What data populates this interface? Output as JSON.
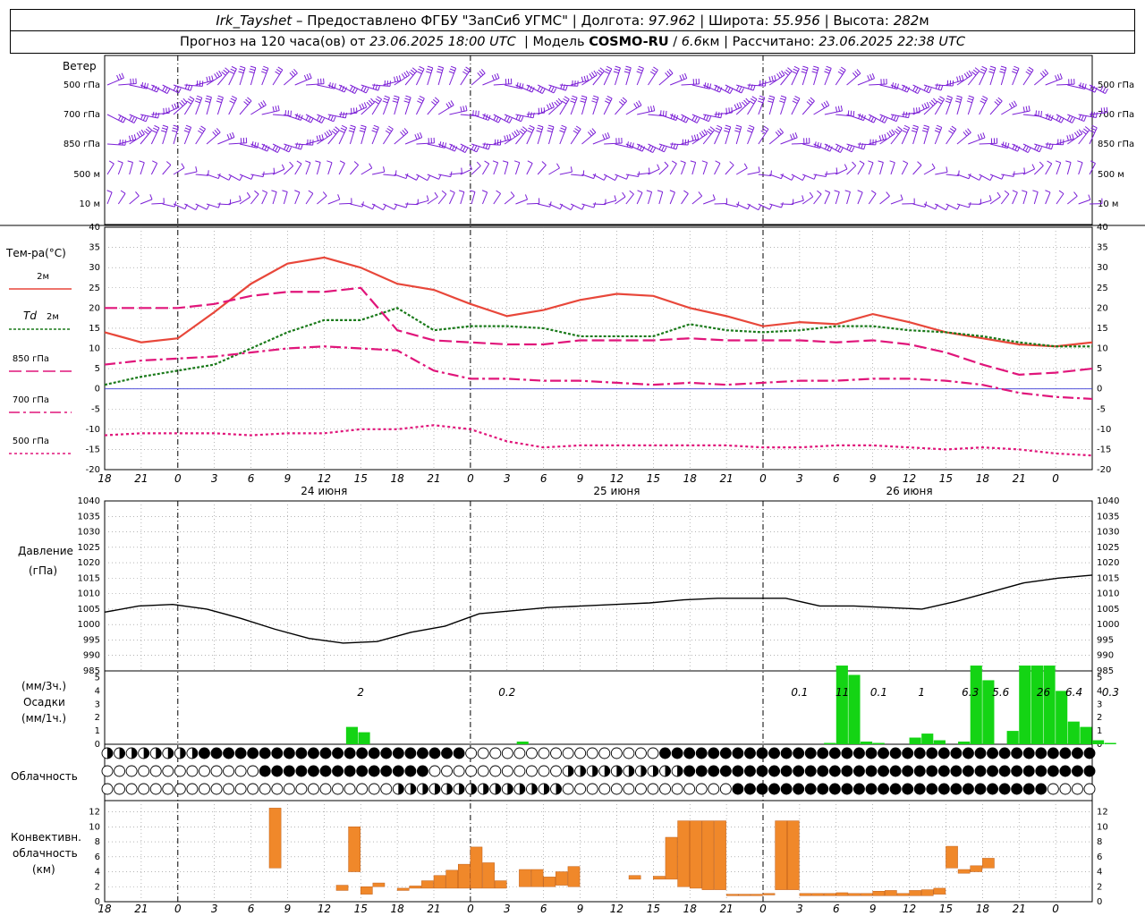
{
  "header": {
    "station": "Irk_Tayshet",
    "provider": "Предоставлено ФГБУ \"ЗапСиб УГМС\"",
    "lon_label": "Долгота:",
    "lon": "97.962",
    "lat_label": "Широта:",
    "lat": "55.956",
    "alt_label": "Высота:",
    "alt": "282",
    "alt_unit": "м",
    "forecast_prefix": "Прогноз на 120 часа(ов) от",
    "forecast_time": "23.06.2025 18:00 UTC",
    "model_label": "Модель",
    "model": "COSMO-RU",
    "model_res": "6.6",
    "model_res_unit": "км",
    "calc_label": "Рассчитано:",
    "calc_time": "23.06.2025 22:38 UTC"
  },
  "wind": {
    "title": "Ветер",
    "levels": [
      "500 гПа",
      "700 гПа",
      "850 гПа",
      "500 м",
      "10 м"
    ],
    "color": "#7b1fd6"
  },
  "temp": {
    "title": "Тем-ра(°C)",
    "legend": [
      {
        "label": "2м",
        "color": "#e8473a"
      },
      {
        "label": "Td",
        "label2": "2м",
        "color": "#1a7a1a"
      },
      {
        "label": "850 гПа",
        "color": "#e0157a"
      },
      {
        "label": "700 гПа",
        "color": "#e0157a"
      },
      {
        "label": "500 гПа",
        "color": "#e0157a"
      }
    ]
  },
  "pressure": {
    "title": "Давление",
    "unit": "(гПа)"
  },
  "precip": {
    "label1": "(мм/3ч.)",
    "label2": "Осадки",
    "label3": "(мм/1ч.)",
    "totals": [
      "2",
      "0.2",
      "0.1",
      "11",
      "0.1",
      "1",
      "6.3",
      "5.6",
      "26",
      "6.4",
      "0.3"
    ],
    "color": "#14d414"
  },
  "clouds": {
    "title": "Облачность"
  },
  "convective": {
    "label1": "Конвективн.",
    "label2": "облачность",
    "label3": "(км)",
    "color": "#f0882a"
  },
  "x_ticks": [
    "18",
    "21",
    "0",
    "3",
    "6",
    "9",
    "12",
    "15",
    "18",
    "21",
    "0",
    "3",
    "6",
    "9",
    "12",
    "15",
    "18",
    "21",
    "0",
    "3",
    "6",
    "9",
    "12",
    "15",
    "18",
    "21",
    "0"
  ],
  "days": [
    "24 июня",
    "25 июня",
    "26 июня"
  ],
  "chart_data": [
    {
      "type": "line",
      "title": "Тем-ра(°C)",
      "x_start": "23.06 18 UTC",
      "x_step_hours": 3,
      "ylim": [
        -20,
        40
      ],
      "yticks": [
        -20,
        -15,
        -10,
        -5,
        0,
        5,
        10,
        15,
        20,
        25,
        30,
        35,
        40
      ],
      "series": [
        {
          "name": "2м",
          "values": [
            14,
            11.5,
            12.5,
            19,
            26,
            31,
            32.5,
            30,
            26,
            24.5,
            21,
            18,
            19.5,
            22,
            23.5,
            23,
            20,
            18,
            15.5,
            16.5,
            16,
            18.5,
            16.5,
            14,
            12.5,
            11,
            10.5,
            11.5
          ]
        },
        {
          "name": "Td 2м",
          "values": [
            1,
            3,
            4.5,
            6,
            10,
            14,
            17,
            17,
            20,
            14.5,
            15.5,
            15.5,
            15,
            13,
            13,
            13,
            16,
            14.5,
            14,
            14.5,
            15.5,
            15.5,
            14.5,
            14,
            13,
            11.5,
            10.5,
            10.5
          ]
        },
        {
          "name": "850 гПа",
          "values": [
            20,
            20,
            20,
            21,
            23,
            24,
            24,
            25,
            14.5,
            12,
            11.5,
            11,
            11,
            12,
            12,
            12,
            12.5,
            12,
            12,
            12,
            11.5,
            12,
            11,
            9,
            6,
            3.5,
            4,
            5
          ]
        },
        {
          "name": "700 гПа",
          "values": [
            6,
            7,
            7.5,
            8,
            9,
            10,
            10.5,
            10,
            9.5,
            4.5,
            2.5,
            2.5,
            2,
            2,
            1.5,
            1,
            1.5,
            1,
            1.5,
            2,
            2,
            2.5,
            2.5,
            2,
            1,
            -1,
            -2,
            -2.5
          ]
        },
        {
          "name": "500 гПа",
          "values": [
            -11.5,
            -11,
            -11,
            -11,
            -11.5,
            -11,
            -11,
            -10,
            -10,
            -9,
            -10,
            -13,
            -14.5,
            -14,
            -14,
            -14,
            -14,
            -14,
            -14.5,
            -14.5,
            -14,
            -14,
            -14.5,
            -15,
            -14.5,
            -15,
            -16,
            -16.5
          ]
        }
      ]
    },
    {
      "type": "line",
      "title": "Давление",
      "ylabel": "(гПа)",
      "ylim": [
        985,
        1040
      ],
      "yticks": [
        985,
        990,
        995,
        1000,
        1005,
        1010,
        1015,
        1020,
        1025,
        1030,
        1035,
        1040
      ],
      "series": [
        {
          "name": "Давление",
          "values": [
            1004,
            1006,
            1006.5,
            1005,
            1002,
            998.5,
            995.5,
            994,
            994.5,
            997.5,
            999.5,
            1003.5,
            1004.5,
            1005.5,
            1006,
            1006.5,
            1007,
            1008,
            1008.5,
            1008.5,
            1008.5,
            1006,
            1006,
            1005.5,
            1005,
            1007.5,
            1010.5,
            1013.5,
            1015,
            1016
          ]
        }
      ]
    },
    {
      "type": "bar",
      "title": "Осадки",
      "ylabel": "(мм/3ч.) (мм/1ч.)",
      "ylim": [
        0,
        5.5
      ],
      "bars": [
        {
          "t": 20.3,
          "v": 1.3
        },
        {
          "t": 21.3,
          "v": 0.9
        },
        {
          "t": 34.3,
          "v": 0.2
        },
        {
          "t": 59.5,
          "v": 0.1
        },
        {
          "t": 60.5,
          "v": 5.9
        },
        {
          "t": 61.5,
          "v": 5.2
        },
        {
          "t": 62.5,
          "v": 0.2
        },
        {
          "t": 63.5,
          "v": 0.1
        },
        {
          "t": 66.5,
          "v": 0.5
        },
        {
          "t": 67.5,
          "v": 0.8
        },
        {
          "t": 68.5,
          "v": 0.3
        },
        {
          "t": 70.5,
          "v": 0.2
        },
        {
          "t": 71.5,
          "v": 5.9
        },
        {
          "t": 72.5,
          "v": 4.8
        },
        {
          "t": 74.5,
          "v": 1
        },
        {
          "t": 75.5,
          "v": 5.9
        },
        {
          "t": 76.5,
          "v": 5.9
        },
        {
          "t": 77.5,
          "v": 5.9
        },
        {
          "t": 78.5,
          "v": 4
        },
        {
          "t": 79.5,
          "v": 1.7
        },
        {
          "t": 80.5,
          "v": 1.3
        },
        {
          "t": 81.5,
          "v": 0.3
        },
        {
          "t": 82.5,
          "v": 0.1
        }
      ]
    },
    {
      "type": "bar",
      "title": "Конвективн. облачность (км)",
      "ylim": [
        0,
        13
      ],
      "bars": [
        {
          "t": 14,
          "lo": 4.5,
          "hi": 12.5
        },
        {
          "t": 19.5,
          "lo": 1.5,
          "hi": 2.2
        },
        {
          "t": 20.5,
          "lo": 4,
          "hi": 10
        },
        {
          "t": 21.5,
          "lo": 1,
          "hi": 2
        },
        {
          "t": 22.5,
          "lo": 2,
          "hi": 2.5
        },
        {
          "t": 24.5,
          "lo": 1.5,
          "hi": 1.8
        },
        {
          "t": 25.5,
          "lo": 1.8,
          "hi": 2.1
        },
        {
          "t": 26.5,
          "lo": 1.8,
          "hi": 2.8
        },
        {
          "t": 27.5,
          "lo": 1.8,
          "hi": 3.5
        },
        {
          "t": 28.5,
          "lo": 1.8,
          "hi": 4.2
        },
        {
          "t": 29.5,
          "lo": 1.8,
          "hi": 5
        },
        {
          "t": 30.5,
          "lo": 1.8,
          "hi": 7.3
        },
        {
          "t": 31.5,
          "lo": 1.8,
          "hi": 5.2
        },
        {
          "t": 32.5,
          "lo": 1.8,
          "hi": 2.8
        },
        {
          "t": 34.5,
          "lo": 2,
          "hi": 4.3
        },
        {
          "t": 35.5,
          "lo": 2,
          "hi": 4.3
        },
        {
          "t": 36.5,
          "lo": 2,
          "hi": 3.3
        },
        {
          "t": 37.5,
          "lo": 2.2,
          "hi": 4
        },
        {
          "t": 38.5,
          "lo": 2,
          "hi": 4.7
        },
        {
          "t": 43.5,
          "lo": 3,
          "hi": 3.5
        },
        {
          "t": 45.5,
          "lo": 3,
          "hi": 3.4
        },
        {
          "t": 46.5,
          "lo": 3,
          "hi": 8.6
        },
        {
          "t": 47.5,
          "lo": 2,
          "hi": 10.8
        },
        {
          "t": 48.5,
          "lo": 1.8,
          "hi": 10.8
        },
        {
          "t": 49.5,
          "lo": 1.6,
          "hi": 10.8
        },
        {
          "t": 50.5,
          "lo": 1.6,
          "hi": 10.8
        },
        {
          "t": 51.5,
          "lo": 0.8,
          "hi": 1
        },
        {
          "t": 52.5,
          "lo": 0.8,
          "hi": 1
        },
        {
          "t": 53.5,
          "lo": 0.8,
          "hi": 1
        },
        {
          "t": 54.5,
          "lo": 0.9,
          "hi": 1.1
        },
        {
          "t": 55.5,
          "lo": 1.6,
          "hi": 10.8
        },
        {
          "t": 56.5,
          "lo": 1.6,
          "hi": 10.8
        },
        {
          "t": 57.5,
          "lo": 0.8,
          "hi": 1.1
        },
        {
          "t": 58.5,
          "lo": 0.8,
          "hi": 1.1
        },
        {
          "t": 59.5,
          "lo": 0.8,
          "hi": 1.1
        },
        {
          "t": 60.5,
          "lo": 0.8,
          "hi": 1.2
        },
        {
          "t": 61.5,
          "lo": 0.8,
          "hi": 1.1
        },
        {
          "t": 62.5,
          "lo": 0.8,
          "hi": 1.1
        },
        {
          "t": 63.5,
          "lo": 0.8,
          "hi": 1.4
        },
        {
          "t": 64.5,
          "lo": 0.8,
          "hi": 1.5
        },
        {
          "t": 65.5,
          "lo": 0.8,
          "hi": 1.1
        },
        {
          "t": 66.5,
          "lo": 0.8,
          "hi": 1.5
        },
        {
          "t": 67.5,
          "lo": 0.8,
          "hi": 1.6
        },
        {
          "t": 68.5,
          "lo": 1,
          "hi": 1.8
        },
        {
          "t": 69.5,
          "lo": 4.5,
          "hi": 7.4
        },
        {
          "t": 70.5,
          "lo": 3.8,
          "hi": 4.3
        },
        {
          "t": 71.5,
          "lo": 4,
          "hi": 4.8
        },
        {
          "t": 72.5,
          "lo": 4.5,
          "hi": 5.8
        }
      ]
    }
  ]
}
